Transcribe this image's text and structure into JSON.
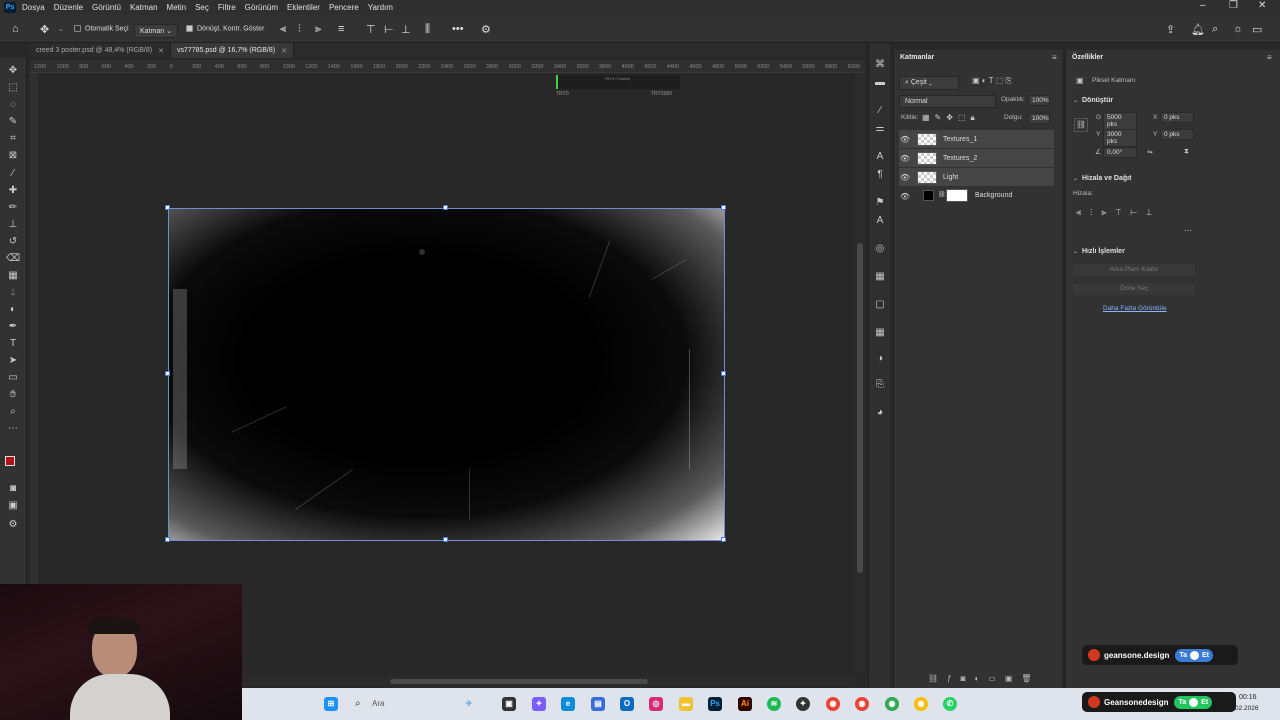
{
  "menu": [
    "Dosya",
    "Düzenle",
    "Görüntü",
    "Katman",
    "Metin",
    "Seç",
    "Filtre",
    "Görünüm",
    "Eklentiler",
    "Pencere",
    "Yardım"
  ],
  "options": {
    "auto_select": "Otomatik Seçi",
    "target": "Katman",
    "show_transform": "Dönüşt. Kontr. Göster"
  },
  "tabs": [
    {
      "label": "creed 3 poster.psd @ 48,4% (RGB/8)"
    },
    {
      "label": "vs77785.psd @ 16,7% (RGB/8)"
    }
  ],
  "ruler_ticks": [
    "1200",
    "1000",
    "800",
    "600",
    "400",
    "200",
    "0",
    "200",
    "400",
    "600",
    "800",
    "1000",
    "1200",
    "1400",
    "1600",
    "1800",
    "2000",
    "2200",
    "2400",
    "2600",
    "2800",
    "3000",
    "3200",
    "3400",
    "3600",
    "3800",
    "4000",
    "4200",
    "4400",
    "4600",
    "4800",
    "5000",
    "5200",
    "5400",
    "5600",
    "5800",
    "6000"
  ],
  "preview": {
    "left": "TRY0",
    "right": "TRY3000",
    "top_label": "TRY0 (Cabins)"
  },
  "layers": {
    "title": "Katmanlar",
    "filter": "Çeşit",
    "blend": "Normal",
    "opacity_label": "Opaklık:",
    "opacity": "100%",
    "lock_label": "Kilitle:",
    "fill_label": "Dolgu:",
    "fill": "100%",
    "items": [
      {
        "name": "Textures_1"
      },
      {
        "name": "Textures_2"
      },
      {
        "name": "Light"
      },
      {
        "name": "Background"
      }
    ]
  },
  "properties": {
    "title": "Özellikler",
    "layer_type": "Piksel Katmanı",
    "transform_title": "Dönüştür",
    "w_label": "G",
    "w": "5000 pks",
    "h_label": "Y",
    "h": "3000 pks",
    "x_label": "X",
    "x": "0 pks",
    "y_label": "Y",
    "y": "0 pks",
    "angle": "0,00°",
    "align_title": "Hizala ve Dağıt",
    "align_label": "Hizala:",
    "quick_title": "Hızlı İşlemler",
    "btn_remove_bg": "Arka Planı Kaldır",
    "btn_select_subject": "Özne Seç",
    "more_link": "Daha Fazla Görüntüle"
  },
  "taskbar": {
    "search": "Ara",
    "time": "00:16",
    "date": "02.2026"
  },
  "brand1": {
    "name": "geansone.design",
    "toggle": "Ta",
    "toggle2": "Et"
  },
  "brand2": {
    "name": "Geansonedesign",
    "toggle": "Ta",
    "toggle2": "Et"
  }
}
